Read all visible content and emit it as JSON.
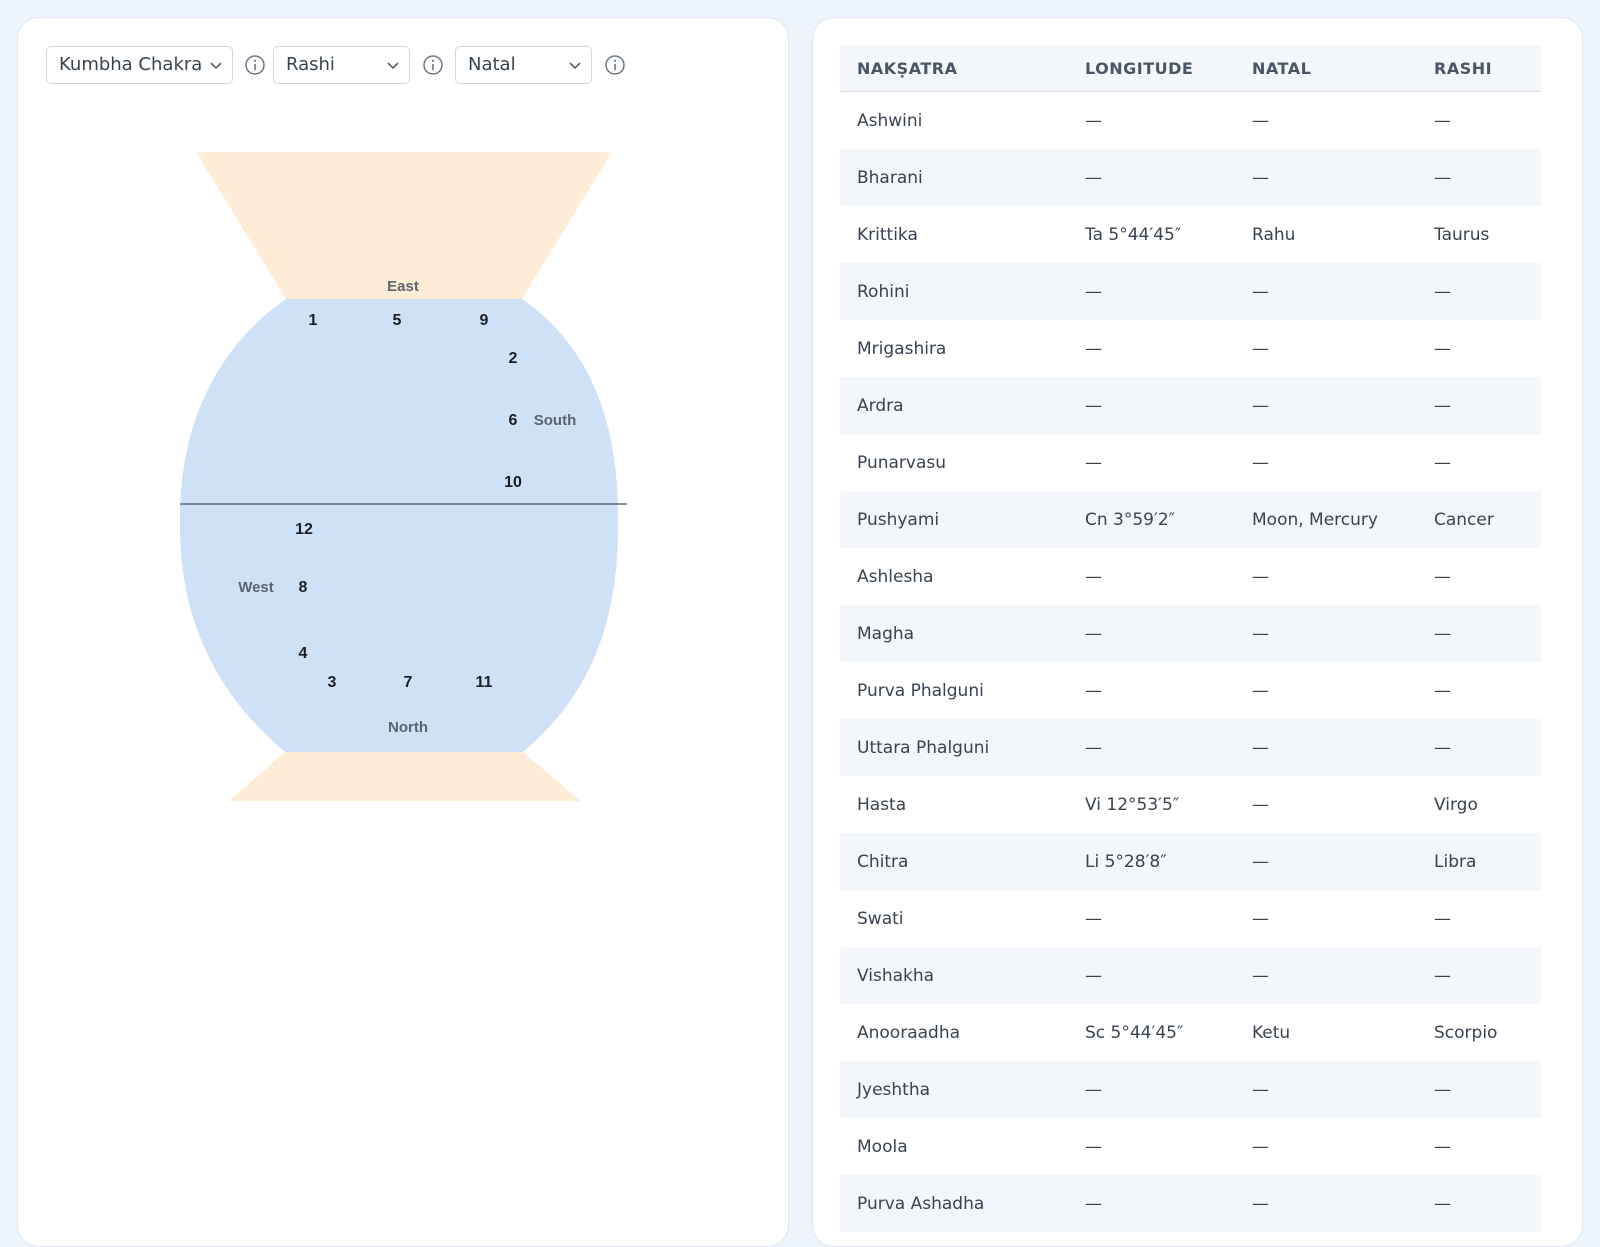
{
  "controls": {
    "chart_select": "Kumbha Chakra",
    "sign_select": "Rashi",
    "chart_type_select": "Natal"
  },
  "chart": {
    "directions": {
      "east": "East",
      "south": "South",
      "west": "West",
      "north": "North"
    },
    "houses": [
      "1",
      "5",
      "9",
      "2",
      "6",
      "10",
      "12",
      "8",
      "4",
      "3",
      "7",
      "11"
    ]
  },
  "table": {
    "headers": [
      "NAKṢATRA",
      "LONGITUDE",
      "NATAL",
      "RASHI"
    ],
    "rows": [
      [
        "Ashwini",
        "—",
        "—",
        "—"
      ],
      [
        "Bharani",
        "—",
        "—",
        "—"
      ],
      [
        "Krittika",
        "Ta 5°44′45″",
        "Rahu",
        "Taurus"
      ],
      [
        "Rohini",
        "—",
        "—",
        "—"
      ],
      [
        "Mrigashira",
        "—",
        "—",
        "—"
      ],
      [
        "Ardra",
        "—",
        "—",
        "—"
      ],
      [
        "Punarvasu",
        "—",
        "—",
        "—"
      ],
      [
        "Pushyami",
        "Cn 3°59′2″",
        "Moon, Mercury",
        "Cancer"
      ],
      [
        "Ashlesha",
        "—",
        "—",
        "—"
      ],
      [
        "Magha",
        "—",
        "—",
        "—"
      ],
      [
        "Purva Phalguni",
        "—",
        "—",
        "—"
      ],
      [
        "Uttara Phalguni",
        "—",
        "—",
        "—"
      ],
      [
        "Hasta",
        "Vi 12°53′5″",
        "—",
        "Virgo"
      ],
      [
        "Chitra",
        "Li 5°28′8″",
        "—",
        "Libra"
      ],
      [
        "Swati",
        "—",
        "—",
        "—"
      ],
      [
        "Vishakha",
        "—",
        "—",
        "—"
      ],
      [
        "Anooraadha",
        "Sc 5°44′45″",
        "Ketu",
        "Scorpio"
      ],
      [
        "Jyeshtha",
        "—",
        "—",
        "—"
      ],
      [
        "Moola",
        "—",
        "—",
        "—"
      ],
      [
        "Purva Ashadha",
        "—",
        "—",
        "—"
      ]
    ]
  },
  "colors": {
    "vessel_body": "#cfe1f6",
    "vessel_ends": "#feecd6",
    "page_bg": "#edf4fc"
  }
}
